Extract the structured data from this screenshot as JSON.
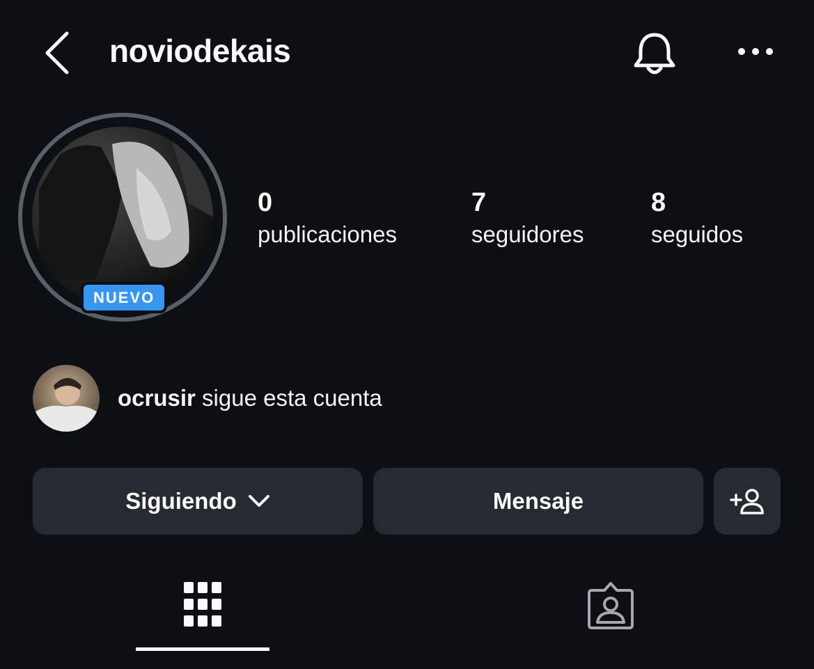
{
  "header": {
    "username": "noviodekais"
  },
  "profile": {
    "badge": "NUEVO"
  },
  "stats": [
    {
      "value": "0",
      "label": "publicaciones"
    },
    {
      "value": "7",
      "label": "seguidores"
    },
    {
      "value": "8",
      "label": "seguidos"
    }
  ],
  "followed_by": {
    "username": "ocrusir",
    "text": "sigue esta cuenta"
  },
  "actions": {
    "following_label": "Siguiendo",
    "message_label": "Mensaje"
  },
  "icons": {
    "back": "chevron-left-icon",
    "notifications": "bell-icon",
    "more": "more-horizontal-icon",
    "dropdown": "chevron-down-icon",
    "suggest": "add-person-icon",
    "grid": "grid-icon",
    "tagged": "tagged-person-icon"
  },
  "colors": {
    "background": "#0c1014",
    "button_background": "#262a31",
    "badge": "#3797f0"
  }
}
